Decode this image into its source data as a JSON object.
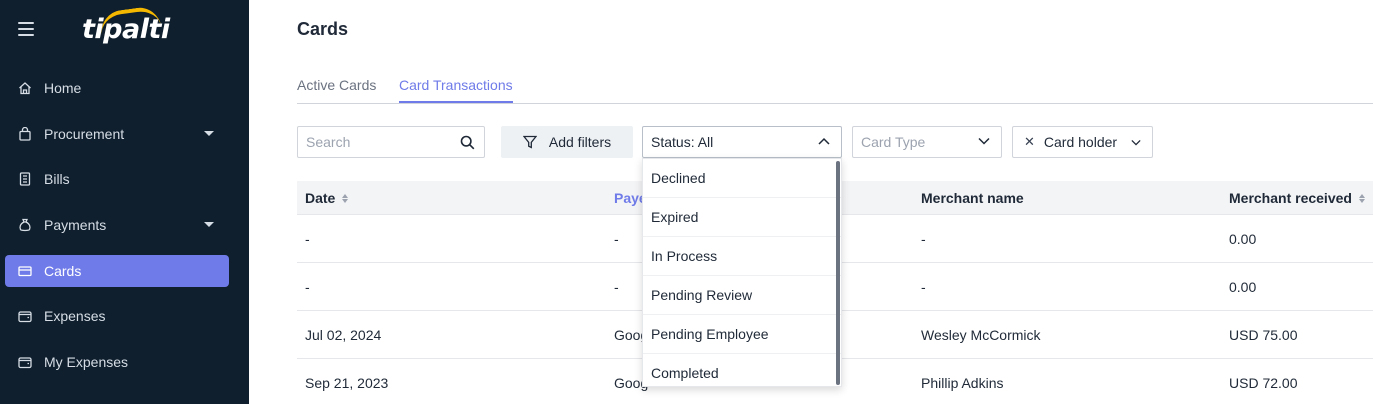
{
  "app": {
    "logo_text": "tipalti",
    "brand_color": "#6f7be8",
    "sidebar_bg": "#0f1f2e",
    "logo_accent": "#f5b800"
  },
  "sidebar": {
    "items": [
      {
        "label": "Home",
        "icon": "home-icon",
        "active": false,
        "expandable": false
      },
      {
        "label": "Procurement",
        "icon": "shopping-bag-icon",
        "active": false,
        "expandable": true
      },
      {
        "label": "Bills",
        "icon": "receipt-icon",
        "active": false,
        "expandable": false
      },
      {
        "label": "Payments",
        "icon": "money-bag-icon",
        "active": false,
        "expandable": true
      },
      {
        "label": "Cards",
        "icon": "credit-card-icon",
        "active": true,
        "expandable": false
      },
      {
        "label": "Expenses",
        "icon": "wallet-icon",
        "active": false,
        "expandable": false
      },
      {
        "label": "My Expenses",
        "icon": "wallet-icon",
        "active": false,
        "expandable": false
      }
    ]
  },
  "page": {
    "title": "Cards"
  },
  "tabs": [
    {
      "label": "Active Cards",
      "active": false
    },
    {
      "label": "Card Transactions",
      "active": true
    }
  ],
  "filters": {
    "search_placeholder": "Search",
    "add_filters_label": "Add filters",
    "status_label": "Status: All",
    "card_type_placeholder": "Card Type",
    "card_holder_label": "Card holder"
  },
  "status_dropdown": {
    "open": true,
    "options": [
      "Declined",
      "Expired",
      "In Process",
      "Pending Review",
      "Pending Employee",
      "Completed"
    ]
  },
  "table": {
    "columns": [
      "Date",
      "Paye",
      "Merchant name",
      "Merchant received"
    ],
    "rows": [
      {
        "date": "-",
        "payee": "-",
        "merchant": "-",
        "received": "0.00"
      },
      {
        "date": "-",
        "payee": "-",
        "merchant": "-",
        "received": "0.00"
      },
      {
        "date": "Jul 02, 2024",
        "payee": "Goog",
        "merchant": "Wesley McCormick",
        "received": "USD 75.00"
      },
      {
        "date": "Sep 21, 2023",
        "payee": "Goog",
        "merchant": "Phillip Adkins",
        "received": "USD 72.00"
      }
    ]
  }
}
